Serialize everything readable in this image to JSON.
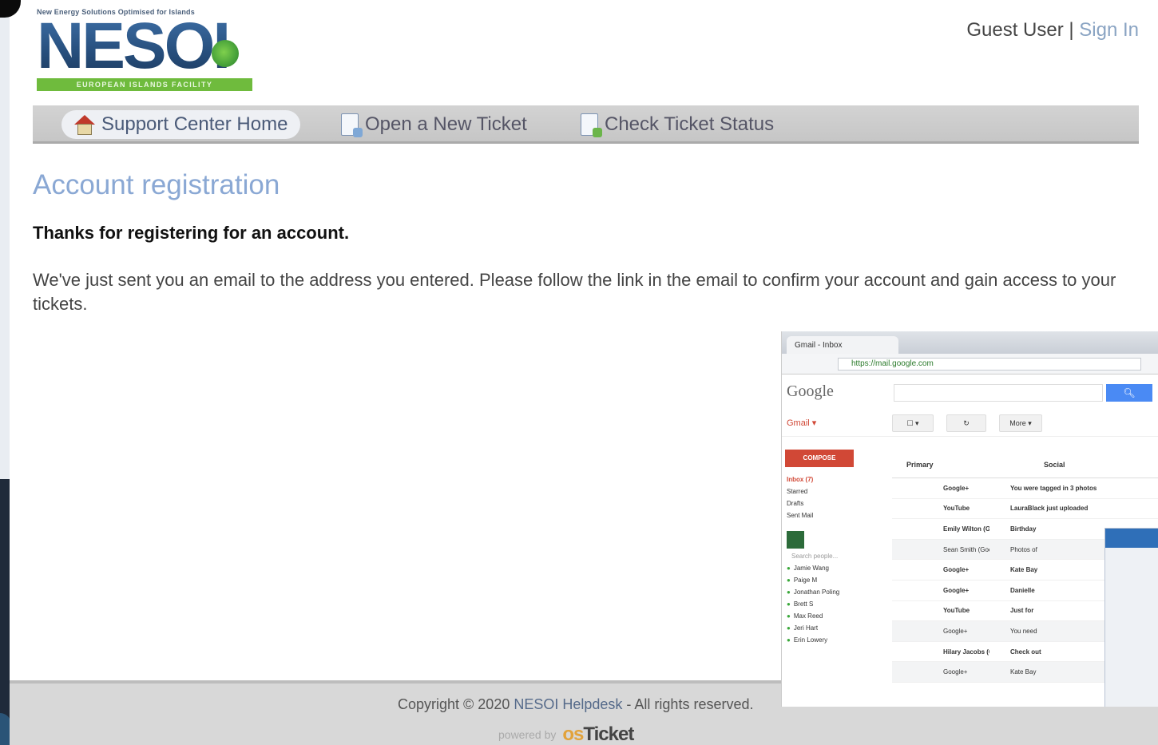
{
  "header": {
    "logo_tagline": "New Energy Solutions Optimised for Islands",
    "logo_word": "NESOI",
    "logo_band": "EUROPEAN ISLANDS FACILITY",
    "user_label": "Guest User",
    "separator": " | ",
    "sign_in": "Sign In"
  },
  "nav": {
    "items": [
      {
        "label": "Support Center Home",
        "icon": "home-icon",
        "active": true
      },
      {
        "label": "Open a New Ticket",
        "icon": "new-ticket-icon",
        "active": false
      },
      {
        "label": "Check Ticket Status",
        "icon": "ticket-status-icon",
        "active": false
      }
    ]
  },
  "main": {
    "title": "Account registration",
    "thanks": "Thanks for registering for an account.",
    "message": "We've just sent you an email to the address you entered. Please follow the link in the email to confirm your account and gain access to your tickets."
  },
  "footer": {
    "copyright_prefix": "Copyright © 2020 ",
    "helpdesk": "NESOI Helpdesk",
    "copyright_suffix": " - All rights reserved.",
    "powered_by": "powered by",
    "brand_os": "os",
    "brand_ticket": "Ticket"
  },
  "gmail_thumbnail": {
    "tab_title": "Gmail - Inbox",
    "url": "https://mail.google.com",
    "google_logo": "Google",
    "gmail_label": "Gmail ▾",
    "more_label": "More ▾",
    "compose": "COMPOSE",
    "sidebar": [
      "Inbox (7)",
      "Starred",
      "Drafts",
      "Sent Mail"
    ],
    "chat_search": "Search people...",
    "chat_people": [
      "Jamie Wang",
      "Paige M",
      "Jonathan Poling",
      "Brett S",
      "Max Reed",
      "Jeri Hart",
      "Erin Lowery"
    ],
    "tabs": [
      "Primary",
      "Social"
    ],
    "rows": [
      {
        "from": "Google+",
        "subject": "You were tagged in 3 photos",
        "read": false
      },
      {
        "from": "YouTube",
        "subject": "LauraBlack just uploaded",
        "read": false
      },
      {
        "from": "Emily Wilton (Google+)",
        "subject": "Birthday",
        "read": false
      },
      {
        "from": "Sean Smith (Google+)",
        "subject": "Photos of",
        "read": true
      },
      {
        "from": "Google+",
        "subject": "Kate Bay",
        "read": false
      },
      {
        "from": "Google+",
        "subject": "Danielle",
        "read": false
      },
      {
        "from": "YouTube",
        "subject": "Just for",
        "read": false
      },
      {
        "from": "Google+",
        "subject": "You need",
        "read": true
      },
      {
        "from": "Hilary Jacobs (Google+)",
        "subject": "Check out",
        "read": false
      },
      {
        "from": "Google+",
        "subject": "Kate Bay",
        "read": true
      }
    ]
  },
  "colors": {
    "title": "#8aa8d4",
    "nav_bg": "#cccccc",
    "footer_bg": "#d8d8d8",
    "logo_blue": "#2f5d8e",
    "logo_green": "#6fbb3d",
    "link": "#8aa4c3"
  }
}
